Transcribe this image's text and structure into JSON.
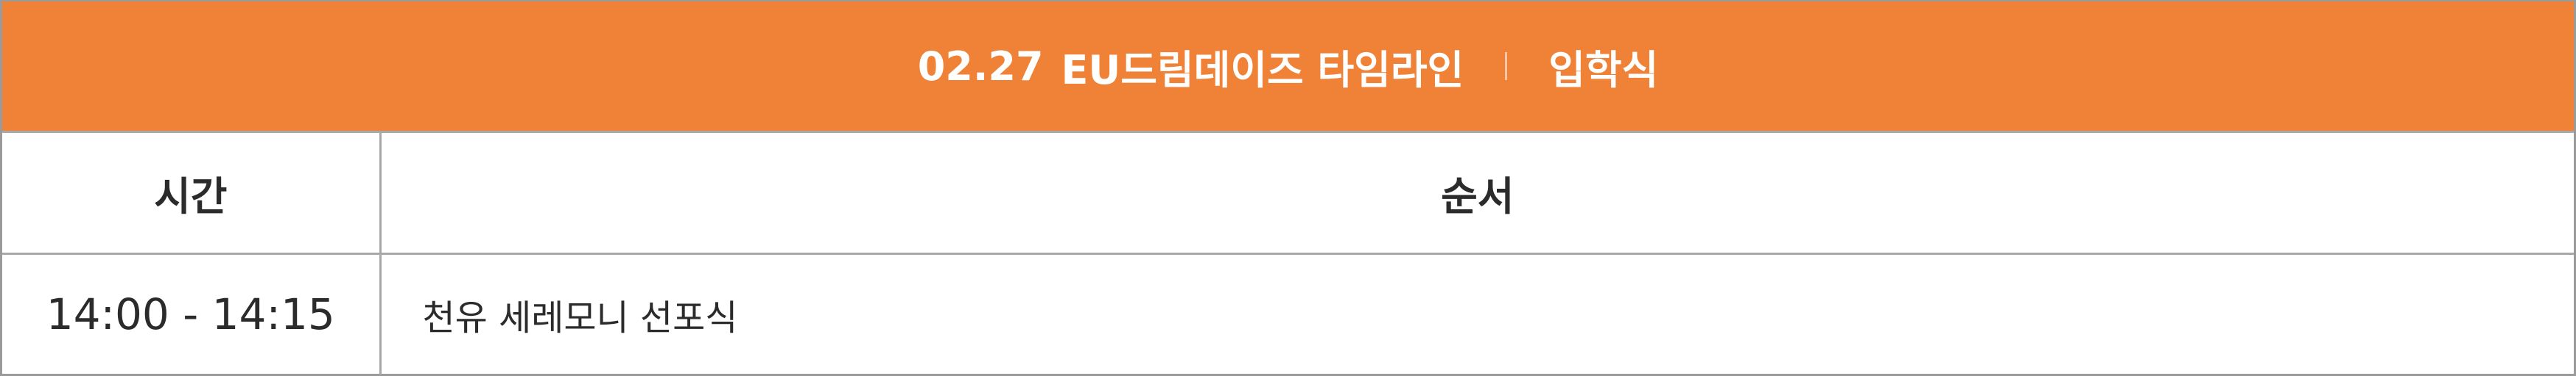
{
  "header": {
    "date": "02.27",
    "title": "EU드림데이즈 타임라인",
    "separator": "|",
    "section": "입학식"
  },
  "table": {
    "columns": [
      "시간",
      "순서"
    ],
    "rows": [
      {
        "time": "14:00 - 14:15",
        "order": "천유 세레모니 선포식"
      }
    ]
  },
  "colors": {
    "header_bg": "#ef8236",
    "header_text": "#ffffff",
    "border": "#a8a8a8",
    "text": "#2b2b2b"
  }
}
